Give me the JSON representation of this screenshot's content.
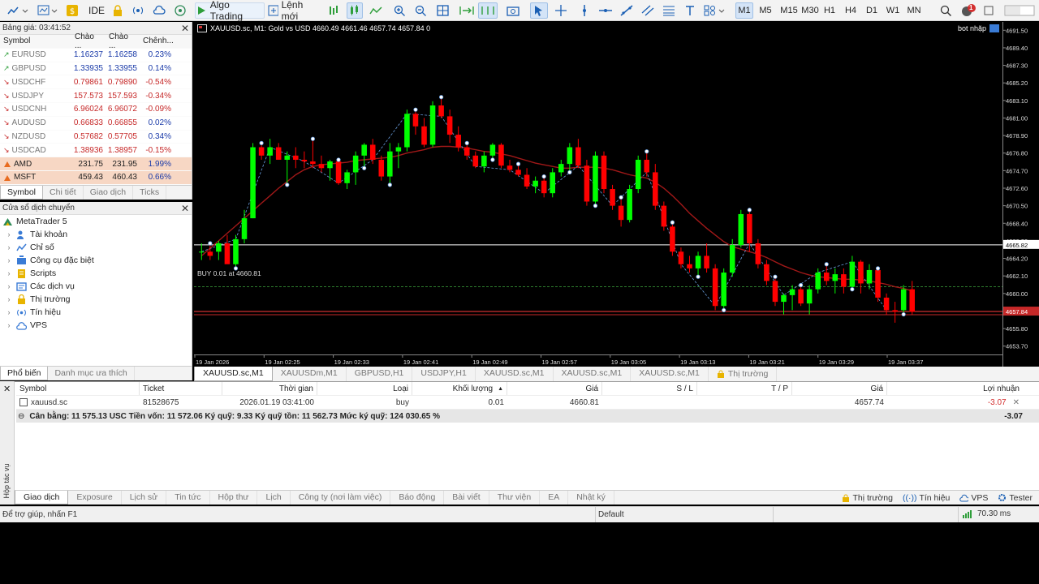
{
  "toolbar": {
    "algo_label": "Algo Trading",
    "new_order_label": "Lệnh mới",
    "ide_label": "IDE",
    "timeframes": [
      "M1",
      "M5",
      "M15",
      "M30",
      "H1",
      "H4",
      "D1",
      "W1",
      "MN"
    ],
    "active_timeframe": "M1",
    "notification_count": "1"
  },
  "market_watch": {
    "title": "Bảng giá: 03:41:52",
    "headers": [
      "Symbol",
      "Chào ...",
      "Chào ...",
      "Chênh..."
    ],
    "rows": [
      {
        "symbol": "EURUSD",
        "bid": "1.16237",
        "ask": "1.16258",
        "chg": "0.23%",
        "dir": "up"
      },
      {
        "symbol": "GBPUSD",
        "bid": "1.33935",
        "ask": "1.33955",
        "chg": "0.14%",
        "dir": "up"
      },
      {
        "symbol": "USDCHF",
        "bid": "0.79861",
        "ask": "0.79890",
        "chg": "-0.54%",
        "dir": "down"
      },
      {
        "symbol": "USDJPY",
        "bid": "157.573",
        "ask": "157.593",
        "chg": "-0.34%",
        "dir": "down"
      },
      {
        "symbol": "USDCNH",
        "bid": "6.96024",
        "ask": "6.96072",
        "chg": "-0.09%",
        "dir": "down"
      },
      {
        "symbol": "AUDUSD",
        "bid": "0.66833",
        "ask": "0.66855",
        "chg": "0.02%",
        "dir": "down"
      },
      {
        "symbol": "NZDUSD",
        "bid": "0.57682",
        "ask": "0.57705",
        "chg": "0.34%",
        "dir": "down"
      },
      {
        "symbol": "USDCAD",
        "bid": "1.38936",
        "ask": "1.38957",
        "chg": "-0.15%",
        "dir": "down"
      },
      {
        "symbol": "AMD",
        "bid": "231.75",
        "ask": "231.95",
        "chg": "1.99%",
        "dir": "stock"
      },
      {
        "symbol": "MSFT",
        "bid": "459.43",
        "ask": "460.43",
        "chg": "0.66%",
        "dir": "stock"
      }
    ],
    "tabs": [
      "Symbol",
      "Chi tiết",
      "Giao dịch",
      "Ticks"
    ]
  },
  "navigator": {
    "title": "Cửa sổ dịch chuyển",
    "root": "MetaTrader 5",
    "items": [
      "Tài khoản",
      "Chỉ số",
      "Công cụ đặc biệt",
      "Scripts",
      "Các dịch vụ",
      "Thị trường",
      "Tín hiệu",
      "VPS"
    ],
    "tabs": [
      "Phổ biến",
      "Danh mục ưa thích"
    ]
  },
  "chart": {
    "header": "XAUUSD.sc, M1:  Gold vs USD  4660.49 4661.46 4657.74 4657.84  0",
    "bot_label": "bot nhặp",
    "buy_label": "BUY 0.01 at 4660.81",
    "current_price": "4657.84",
    "crosshair_price": "4665.82",
    "price_ticks": [
      "4691.50",
      "4689.40",
      "4687.30",
      "4685.20",
      "4683.10",
      "4681.00",
      "4678.90",
      "4676.80",
      "4674.70",
      "4672.60",
      "4670.50",
      "4668.40",
      "4666.30",
      "4664.20",
      "4662.10",
      "4660.00",
      "4657.90",
      "4655.80",
      "4653.70"
    ],
    "time_ticks": [
      "19 Jan 2026",
      "19 Jan 02:25",
      "19 Jan 02:33",
      "19 Jan 02:41",
      "19 Jan 02:49",
      "19 Jan 02:57",
      "19 Jan 03:05",
      "19 Jan 03:13",
      "19 Jan 03:21",
      "19 Jan 03:29",
      "19 Jan 03:37"
    ]
  },
  "chart_tabs": [
    "XAUUSD.sc,M1",
    "XAUUSDm,M1",
    "GBPUSD,H1",
    "USDJPY,H1",
    "XAUUSD.sc,M1",
    "XAUUSD.sc,M1",
    "XAUUSD.sc,M1",
    "Thị trường"
  ],
  "chart_data": {
    "type": "candlestick",
    "symbol": "XAUUSD.sc",
    "timeframe": "M1",
    "ylim": [
      4652.7,
      4692.5
    ],
    "candles": [
      [
        4665,
        4666,
        4664,
        4665
      ],
      [
        4665,
        4666,
        4664,
        4664.5
      ],
      [
        4665,
        4666.3,
        4664,
        4666
      ],
      [
        4666,
        4667,
        4664,
        4663.5
      ],
      [
        4663.5,
        4667,
        4663,
        4666.5
      ],
      [
        4666.5,
        4670,
        4666,
        4669
      ],
      [
        4669,
        4678,
        4669,
        4677.5
      ],
      [
        4677.5,
        4678,
        4676,
        4676.5
      ],
      [
        4676.5,
        4678.5,
        4675.5,
        4677.5
      ],
      [
        4677.5,
        4678,
        4676,
        4676
      ],
      [
        4676,
        4677,
        4673,
        4676.5
      ],
      [
        4676.5,
        4677.5,
        4675,
        4676
      ],
      [
        4676,
        4677,
        4675,
        4675.8
      ],
      [
        4675.8,
        4678.5,
        4675,
        4675.5
      ],
      [
        4675.5,
        4676.5,
        4674.5,
        4675
      ],
      [
        4675,
        4676,
        4673.5,
        4675.8
      ],
      [
        4675.8,
        4676,
        4673,
        4673.2
      ],
      [
        4673.2,
        4674.8,
        4672.5,
        4674.5
      ],
      [
        4674.5,
        4677,
        4673,
        4676.5
      ],
      [
        4676.5,
        4678,
        4675,
        4677.8
      ],
      [
        4677.8,
        4678.5,
        4675.5,
        4676
      ],
      [
        4676,
        4676.5,
        4673.5,
        4674
      ],
      [
        4674,
        4678,
        4673,
        4677
      ],
      [
        4677,
        4678,
        4675,
        4677.5
      ],
      [
        4677.5,
        4682,
        4677,
        4681.5
      ],
      [
        4681.5,
        4682,
        4679,
        4680
      ],
      [
        4680,
        4681,
        4677.5,
        4677.8
      ],
      [
        4677.8,
        4683,
        4677.5,
        4682.5
      ],
      [
        4682.5,
        4683.5,
        4681,
        4681.2
      ],
      [
        4681.2,
        4682,
        4678,
        4679
      ],
      [
        4679,
        4680,
        4677,
        4677.5
      ],
      [
        4677.5,
        4678,
        4676,
        4676.5
      ],
      [
        4676.5,
        4677,
        4675,
        4675.2
      ],
      [
        4675.2,
        4677,
        4674.5,
        4676.5
      ],
      [
        4676.5,
        4678,
        4676,
        4677.8
      ],
      [
        4677.8,
        4678,
        4675,
        4675.3
      ],
      [
        4675.3,
        4676,
        4674.5,
        4674.8
      ],
      [
        4674.8,
        4675.5,
        4674,
        4674.2
      ],
      [
        4674.2,
        4675,
        4672.5,
        4672.8
      ],
      [
        4672.8,
        4674,
        4672,
        4673.5
      ],
      [
        4673.5,
        4674,
        4671.5,
        4672
      ],
      [
        4672,
        4675,
        4671.5,
        4674.5
      ],
      [
        4674.5,
        4676,
        4674,
        4675.5
      ],
      [
        4675.5,
        4678,
        4674.5,
        4677.5
      ],
      [
        4677.5,
        4678.5,
        4675,
        4675.3
      ],
      [
        4675.3,
        4676,
        4670.5,
        4671
      ],
      [
        4671,
        4677,
        4670.5,
        4676.5
      ],
      [
        4676.5,
        4677,
        4672,
        4672.5
      ],
      [
        4672.5,
        4673,
        4670,
        4670.5
      ],
      [
        4670.5,
        4671.5,
        4668,
        4668.8
      ],
      [
        4668.8,
        4673,
        4668.5,
        4672.5
      ],
      [
        4672.5,
        4676.5,
        4672,
        4676
      ],
      [
        4676,
        4677,
        4674,
        4674.5
      ],
      [
        4674.5,
        4675.5,
        4670,
        4670.5
      ],
      [
        4670.5,
        4671,
        4667.5,
        4668
      ],
      [
        4668,
        4668.5,
        4664.5,
        4665
      ],
      [
        4665,
        4665.5,
        4663,
        4663.5
      ],
      [
        4663.5,
        4664.5,
        4662.5,
        4663
      ],
      [
        4663,
        4665,
        4662,
        4664.5
      ],
      [
        4664.5,
        4666,
        4662.5,
        4663
      ],
      [
        4663,
        4663.5,
        4658,
        4658.5
      ],
      [
        4658.5,
        4663,
        4658,
        4662.5
      ],
      [
        4662.5,
        4666.5,
        4662,
        4665.8
      ],
      [
        4665.8,
        4670,
        4665.5,
        4669.5
      ],
      [
        4669.5,
        4670,
        4665,
        4666
      ],
      [
        4666,
        4666.5,
        4663,
        4663.5
      ],
      [
        4663.5,
        4664,
        4661,
        4661.5
      ],
      [
        4661.5,
        4662,
        4658.5,
        4659
      ],
      [
        4659,
        4660,
        4657.5,
        4659.8
      ],
      [
        4659.8,
        4661,
        4658,
        4660.5
      ],
      [
        4660.5,
        4661,
        4658.5,
        4658.8
      ],
      [
        4658.8,
        4661,
        4657.5,
        4660.5
      ],
      [
        4660.5,
        4663,
        4660,
        4662.5
      ],
      [
        4662.5,
        4663.5,
        4661,
        4661.5
      ],
      [
        4661.5,
        4663,
        4660,
        4662.3
      ],
      [
        4662.3,
        4663,
        4660,
        4660.8
      ],
      [
        4660.8,
        4664.5,
        4660.5,
        4663.8
      ],
      [
        4663.8,
        4664,
        4660,
        4661.2
      ],
      [
        4661.2,
        4663.5,
        4660.5,
        4662.8
      ],
      [
        4662.8,
        4663,
        4659,
        4659.5
      ],
      [
        4659.5,
        4660,
        4657.5,
        4658
      ],
      [
        4658,
        4659,
        4656.5,
        4657.8
      ],
      [
        4658,
        4661,
        4657.5,
        4660.5
      ],
      [
        4660.5,
        4661.5,
        4657.5,
        4657.8
      ]
    ],
    "ma": [
      4664.5,
      4665.4,
      4666.3,
      4667.2,
      4668.1,
      4669.0,
      4669.9,
      4670.8,
      4671.7,
      4672.6,
      4673.4,
      4674.2,
      4674.8,
      4675.2,
      4675.4,
      4675.5,
      4675.6,
      4675.7,
      4675.9,
      4676.0,
      4676.1,
      4676.2,
      4676.3,
      4676.5,
      4676.8,
      4677.0,
      4677.2,
      4677.5,
      4677.6,
      4677.6,
      4677.5,
      4677.4,
      4677.2,
      4677.0,
      4676.9,
      4676.7,
      4676.5,
      4676.2,
      4675.9,
      4675.6,
      4675.4,
      4675.2,
      4675.0,
      4675.0,
      4675.1,
      4675.1,
      4675.1,
      4675.0,
      4674.8,
      4674.5,
      4674.2,
      4674.0,
      4673.8,
      4673.3,
      4672.6,
      4671.7,
      4670.7,
      4669.6,
      4668.7,
      4667.8,
      4667.0,
      4666.2,
      4665.6,
      4665.3,
      4665.0,
      4664.7,
      4664.3,
      4663.8,
      4663.3,
      4662.9,
      4662.5,
      4662.2,
      4662.0,
      4661.9,
      4661.8,
      4661.7,
      4661.7,
      4661.6,
      4661.5,
      4661.3,
      4661.1,
      4660.8,
      4660.6,
      4660.3
    ],
    "levels": {
      "current": 4657.84,
      "buy": 4660.81,
      "crosshair": 4665.82
    }
  },
  "toolbox": {
    "headers": [
      "Symbol",
      "Ticket",
      "Thời gian",
      "Loại",
      "Khối lượng",
      "Giá",
      "S / L",
      "T / P",
      "Giá",
      "Lợi nhuận"
    ],
    "row": {
      "symbol": "xauusd.sc",
      "ticket": "81528675",
      "time": "2026.01.19 03:41:00",
      "type": "buy",
      "volume": "0.01",
      "price": "4660.81",
      "sl": "",
      "tp": "",
      "cur": "4657.74",
      "profit": "-3.07"
    },
    "balance": "Cân bằng: 11 575.13 USC  Tiền vốn: 11 572.06  Ký quỹ: 9.33  Ký quỹ tồn: 11 562.73  Mức ký quỹ: 124 030.65 %",
    "balance_profit": "-3.07",
    "side_label": "Hộp tác vụ",
    "tabs": [
      "Giao dịch",
      "Exposure",
      "Lịch sử",
      "Tin tức",
      "Hộp thư",
      "Lịch",
      "Công ty (nơi làm việc)",
      "Báo động",
      "Bài viết",
      "Thư viện",
      "EA",
      "Nhật ký"
    ],
    "right_tabs": [
      "Thị trường",
      "Tín hiệu",
      "VPS",
      "Tester"
    ]
  },
  "status": {
    "help": "Để trợ giúp, nhấn F1",
    "profile": "Default",
    "ping": "70.30 ms"
  },
  "colors": {
    "bull": "#00ff00",
    "bear": "#ff0000",
    "ma": "#a01818",
    "buy_line": "#2e7d2e",
    "price_line": "#ff3b3b",
    "crosshair": "#ffffff"
  }
}
